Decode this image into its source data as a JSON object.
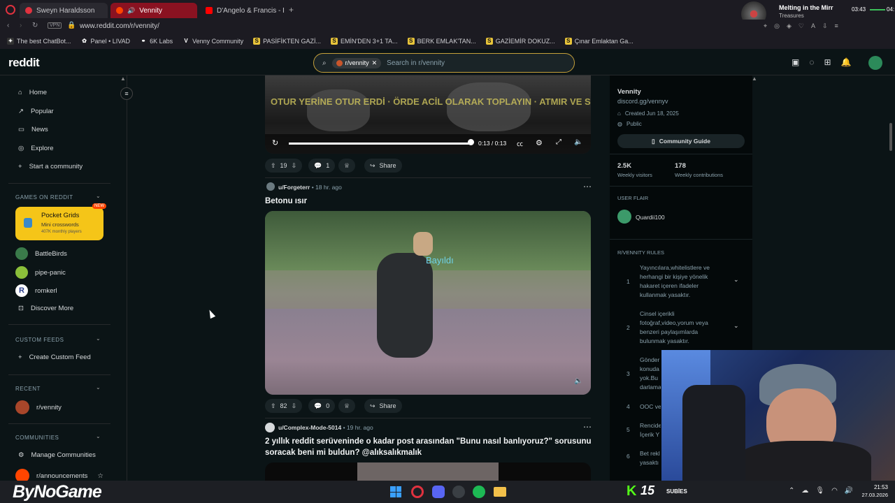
{
  "browser": {
    "tabs": [
      {
        "label": "Sweyn Haraldsson",
        "color": "#e0323f"
      },
      {
        "label": "Vennity",
        "color": "#ff4500"
      },
      {
        "label": "D'Angelo & Francis - Blad",
        "color": "#ff0000"
      }
    ],
    "url": "www.reddit.com/r/vennity/",
    "vpn": "VPN",
    "bookmarks": [
      "The best ChatBot...",
      "Panel • LIVAD",
      "6K Labs",
      "Venny Community",
      "PASİFİKTEN GAZİ...",
      "EMİN'DEN 3+1 TA...",
      "BERK EMLAK'TAN...",
      "GAZİEMİR DOKUZ...",
      "Çınar Emlaktan Ga..."
    ],
    "media_widget": {
      "title": "Melting in the Mirr",
      "artist": "Treasures",
      "elapsed": "03:43",
      "remaining": "04:"
    }
  },
  "reddit": {
    "logo": "reddit",
    "search": {
      "chip": "r/vennity",
      "placeholder": "Search in r/vennity"
    }
  },
  "leftnav": {
    "items": [
      "Home",
      "Popular",
      "News",
      "Explore",
      "Start a community"
    ],
    "games_title": "GAMES ON REDDIT",
    "featured_game": {
      "title": "Pocket Grids",
      "subtitle": "Mini crosswords",
      "players": "407K monthly players",
      "badge": "NEW"
    },
    "games": [
      "BattleBirds",
      "pipe-panic",
      "romkerl",
      "Discover More"
    ],
    "custom_feeds_title": "CUSTOM FEEDS",
    "create_custom_feed": "Create Custom Feed",
    "recent_title": "RECENT",
    "recent": [
      "r/vennity"
    ],
    "communities_title": "COMMUNITIES",
    "communities": [
      "Manage Communities",
      "r/announcements"
    ]
  },
  "feed": {
    "video1": {
      "time": "0:13 / 0:13",
      "progress": 1.0,
      "overlay_text": "OTUR YERİNE OTUR ERDİ · ÖRDE ACİL OLARAK TOPLAYIN · ATMIR VE S"
    },
    "post1_actions": {
      "votes": "19",
      "comments": "1",
      "share": "Share"
    },
    "post2": {
      "author": "u/Forgeterr",
      "time": "18 hr. ago",
      "title": "Betonu ısır",
      "overlay_text": "Bayıldı",
      "votes": "82",
      "comments": "0",
      "share": "Share"
    },
    "post3": {
      "author": "u/Complex-Mode-5014",
      "time": "19 hr. ago",
      "title_line1": "2 yıllık reddit serüveninde o kadar post arasından \"Bunu nasıl banlıyoruz?\" sorusunu",
      "title_line2": "soracak beni mi buldun? @alıksalıkmalık"
    }
  },
  "sidebar": {
    "name": "Vennity",
    "link": "discord.gg/vennyv",
    "created": "Created Jun 18, 2025",
    "visibility": "Public",
    "guide_button": "Community Guide",
    "stats": [
      {
        "value": "2.5K",
        "label": "Weekly visitors"
      },
      {
        "value": "178",
        "label": "Weekly contributions"
      }
    ],
    "flair_title": "USER FLAIR",
    "flair_user": "Quardii100",
    "rules_title": "R/VENNITY RULES",
    "rules": [
      {
        "n": "1",
        "text": "Yayıncılara,whitelistlere ve herhangi bir kişiye yönelik hakaret içeren ifadeler kullanmak yasaktır."
      },
      {
        "n": "2",
        "text": "Cinsel içerikli fotoğraf,video,yorum veya benzeri paylaşımlarda bulunmak yasaktır."
      },
      {
        "n": "3",
        "text": "Gönder konuda yok.Bu darlama"
      },
      {
        "n": "4",
        "text": "OOC ve"
      },
      {
        "n": "5",
        "text": "Rencide İçerik Y"
      },
      {
        "n": "6",
        "text": "Bet rekl yasaktı"
      }
    ]
  },
  "overlay": {
    "watermark": "ByNoGame",
    "kick_count": "15",
    "subs_label": "SUBİES"
  },
  "taskbar": {
    "time": "21:53",
    "date": "27.03.2026"
  },
  "colors": {
    "bg": "#0b1416",
    "accent": "#ff4500",
    "tab_active": "#8a1221",
    "game_card": "#f5c518"
  }
}
